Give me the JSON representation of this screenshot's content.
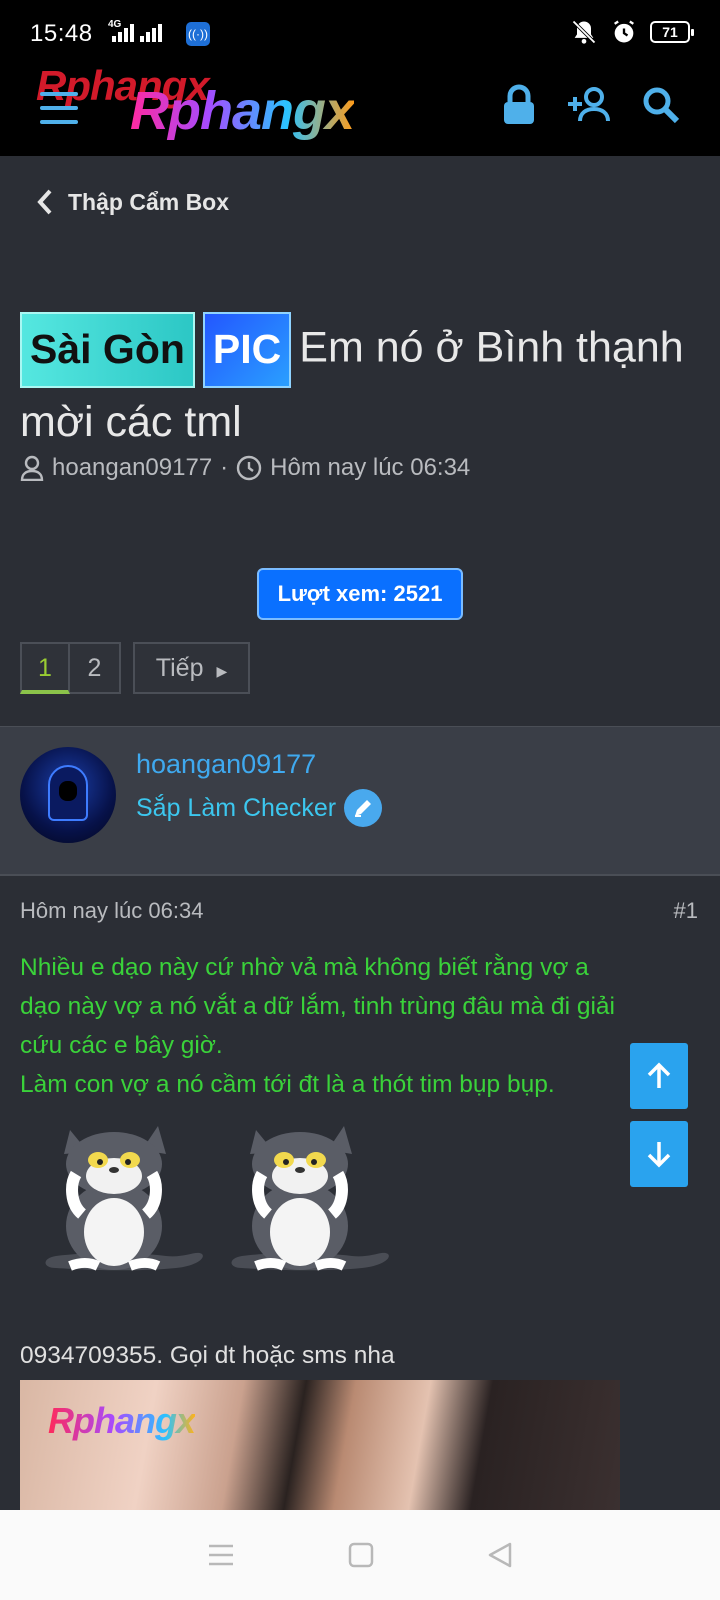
{
  "status_bar": {
    "time": "15:48",
    "network_label": "4G",
    "battery": "71"
  },
  "header": {
    "logo_text": "Rphangx",
    "icons": [
      "menu-icon",
      "lock-icon",
      "add-user-icon",
      "search-icon"
    ]
  },
  "breadcrumb": {
    "label": "Thập Cẩm Box"
  },
  "thread": {
    "prefix_location": "Sài Gòn",
    "prefix_type": "PIC",
    "title": "Em nó ở Bình thạnh mời các tml",
    "author": "hoangan09177",
    "separator": "·",
    "time": "Hôm nay lúc 06:34"
  },
  "views_label": "Lượt xem: 2521",
  "pagination": {
    "pages": [
      "1",
      "2"
    ],
    "current": "1",
    "next_label": "Tiếp"
  },
  "post": {
    "username": "hoangan09177",
    "rank": "Sắp Làm Checker",
    "time": "Hôm nay lúc 06:34",
    "number": "#1",
    "body_lines": [
      "Nhiều e dạo này cứ nhờ vả mà không biết rằng vợ a",
      "dạo này vợ a nó vắt a dữ lắm, tinh trùng đâu mà đi giải",
      "cứu các e bây giờ.",
      "Làm con vợ a nó cầm tới đt là a thót tim bụp bụp."
    ],
    "phone_line": "0934709355. Gọi dt hoặc sms nha",
    "image_watermark": "Rphangx"
  },
  "colors": {
    "accent_blue": "#2aa3ee",
    "post_text_green": "#3ad23a",
    "views_button": "#0a70ff",
    "page_bg": "#2b2e35"
  }
}
